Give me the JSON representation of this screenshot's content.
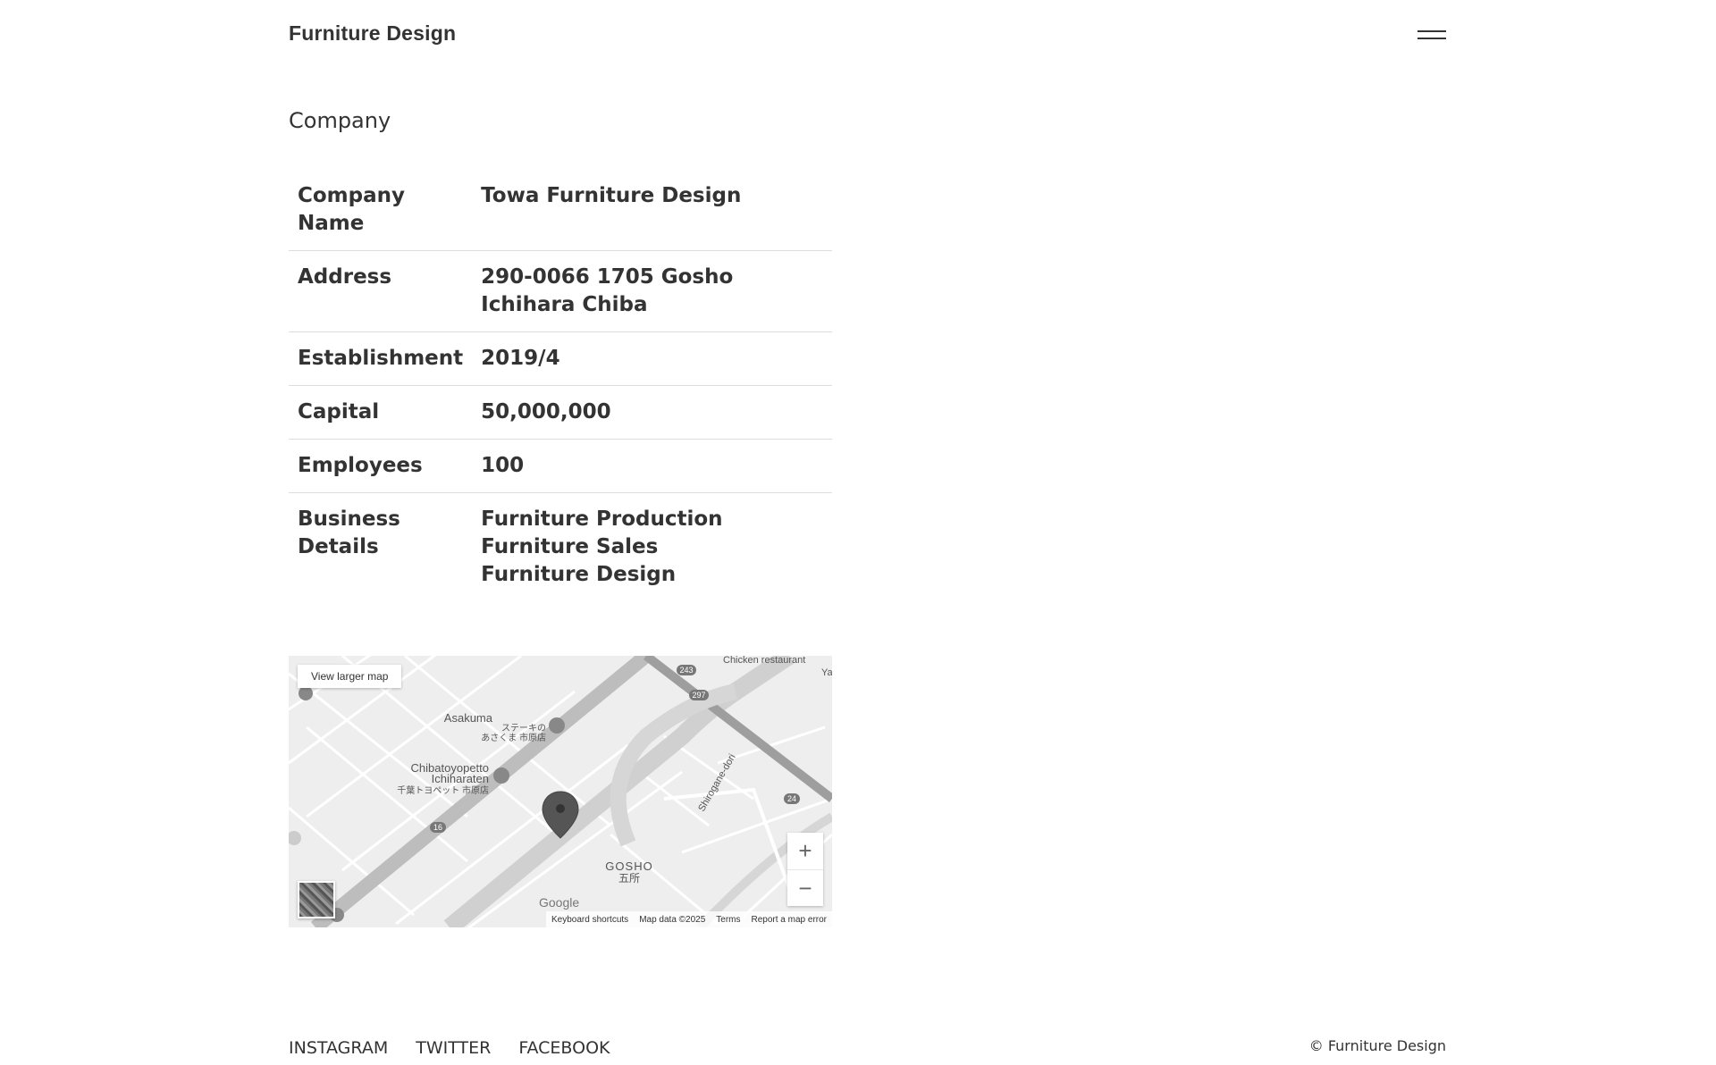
{
  "header": {
    "logo": "Furniture Design",
    "menu_icon": "hamburger-icon"
  },
  "section": {
    "title": "Company"
  },
  "company_table": {
    "rows": [
      {
        "label": "Company Name",
        "value": "Towa Furniture Design"
      },
      {
        "label": "Address",
        "value": "290-0066 1705 Gosho Ichihara Chiba"
      },
      {
        "label": "Establishment",
        "value": "2019/4"
      },
      {
        "label": "Capital",
        "value": "50,000,000"
      },
      {
        "label": "Employees",
        "value": "100"
      },
      {
        "label": "Business Details",
        "values": [
          "Furniture Production",
          "Furniture Sales",
          "Furniture Design"
        ]
      }
    ]
  },
  "map": {
    "view_larger": "View larger map",
    "zoom_in": "+",
    "zoom_out": "−",
    "labels": {
      "chicken": "Chicken restaurant",
      "ya": "Ya",
      "asakuma": "Asakuma",
      "asakuma_jp1": "ステーキの",
      "asakuma_jp2": "あさくま 市原店",
      "chibatoyo1": "Chibatoyopetto",
      "chibatoyo2": "Ichiharaten",
      "chibatoyo_jp": "千葉トヨペット 市原店",
      "shirogane": "Shirogane-dori",
      "gosho": "GOSHO",
      "gosho_jp": "五所",
      "r243": "243",
      "r297": "297",
      "r24": "24",
      "r16": "16",
      "google": "Google"
    },
    "attribution": {
      "shortcuts": "Keyboard shortcuts",
      "data": "Map data ©2025",
      "terms": "Terms",
      "report": "Report a map error"
    }
  },
  "footer": {
    "links": [
      "INSTAGRAM",
      "TWITTER",
      "FACEBOOK"
    ],
    "copyright": "© Furniture Design"
  }
}
